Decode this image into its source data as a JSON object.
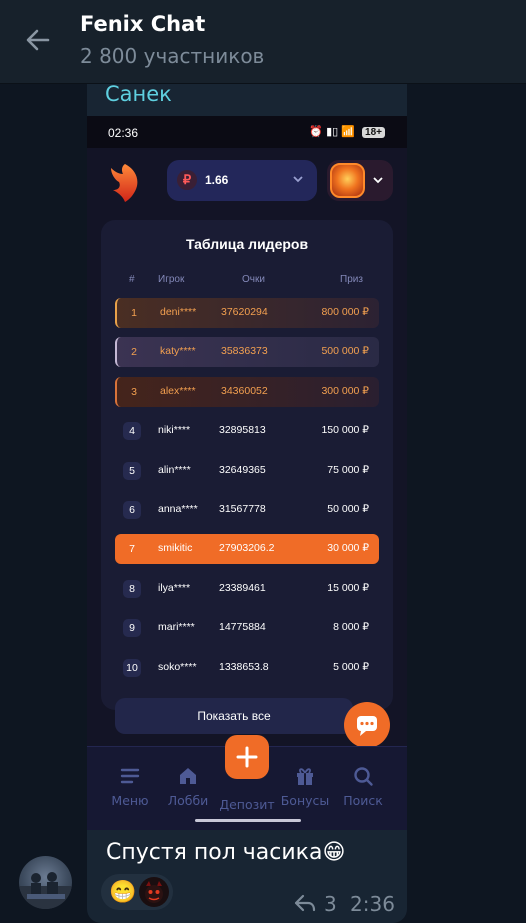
{
  "header": {
    "title": "Fenix Chat",
    "subtitle": "2 800 участников"
  },
  "message": {
    "sender": "Санек",
    "text": "Спустя пол часика😁",
    "reply_count": "3",
    "time": "2:36",
    "reaction_emoji": "😁"
  },
  "screenshot": {
    "status_time": "02:36",
    "status_icons": "⏰ ▮▯ 📶 ",
    "battery": "18+",
    "balance_symbol": "₽",
    "balance": "1.66",
    "leaderboard_title": "Таблица лидеров",
    "columns": {
      "rank": "#",
      "player": "Игрок",
      "score": "Очки",
      "prize": "Приз"
    },
    "rows": [
      {
        "rank": "1",
        "player": "deni****",
        "score": "37620294",
        "prize": "800 000 ₽"
      },
      {
        "rank": "2",
        "player": "katy****",
        "score": "35836373",
        "prize": "500 000 ₽"
      },
      {
        "rank": "3",
        "player": "alex****",
        "score": "34360052",
        "prize": "300 000 ₽"
      },
      {
        "rank": "4",
        "player": "niki****",
        "score": "32895813",
        "prize": "150 000 ₽"
      },
      {
        "rank": "5",
        "player": "alin****",
        "score": "32649365",
        "prize": "75 000 ₽"
      },
      {
        "rank": "6",
        "player": "anna****",
        "score": "31567778",
        "prize": "50 000 ₽"
      },
      {
        "rank": "7",
        "player": "smikitic",
        "score": "27903206.2",
        "prize": "30 000 ₽"
      },
      {
        "rank": "8",
        "player": "ilya****",
        "score": "23389461",
        "prize": "15 000 ₽"
      },
      {
        "rank": "9",
        "player": "mari****",
        "score": "14775884",
        "prize": "8 000 ₽"
      },
      {
        "rank": "10",
        "player": "soko****",
        "score": "1338653.8",
        "prize": "5 000 ₽"
      }
    ],
    "show_all": "Показать все",
    "nav": {
      "menu": "Меню",
      "lobby": "Лобби",
      "deposit": "Депозит",
      "bonuses": "Бонусы",
      "search": "Поиск"
    }
  },
  "colors": {
    "accent_orange": "#f06c27",
    "sender_name": "#5fd0e0",
    "telegram_bg": "#0e1621",
    "muted": "#7d8b99"
  }
}
